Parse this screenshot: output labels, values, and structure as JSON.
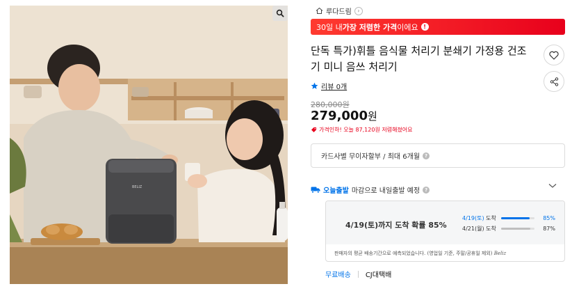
{
  "store": {
    "name": "루다드림",
    "chevron": "›"
  },
  "banner": {
    "prefix": "30일 내 ",
    "highlight": "가장 저렴한 가격",
    "suffix": "이에요",
    "info_icon": "!"
  },
  "product": {
    "title": "단독 특가)휘틀 음식물 처리기 분쇄기 가정용 건조기 미니 음쓰 처리기",
    "review_label": "리뷰 0개",
    "original_price": "280,000원",
    "sale_price_number": "279,000",
    "sale_price_unit": "원",
    "price_drop_note": "가격인하! 오늘 87,120원 저렴해졌어요"
  },
  "card_info": {
    "label": "카드사별 무이자할부 / 최대 6개월",
    "help": "?"
  },
  "shipping": {
    "badge": "오늘출발",
    "label": "마감으로 내일출발 예정",
    "help": "?"
  },
  "arrival": {
    "headline": "4/19(토)까지 도착 확률 85%",
    "stats": [
      {
        "date": "4/19(토)",
        "suffix": "도착",
        "percent": 85,
        "label": "85%",
        "color": "#0073e9"
      },
      {
        "date": "4/21(월)",
        "suffix": "도착",
        "percent": 87,
        "label": "87%",
        "color": "#bfbfbf"
      }
    ],
    "footnote": "판매자의 평균 배송기간으로 예측되었습니다. (영업일 기준, 주말/공휴일 제외)",
    "brand_mark": "Beliz"
  },
  "delivery": {
    "free": "무료배송",
    "courier": "CJ대택배"
  },
  "colors": {
    "accent_red": "#e8001c",
    "accent_blue": "#0073e9"
  },
  "icons": {
    "zoom": "magnifier-icon",
    "home": "home-icon",
    "heart": "heart-icon",
    "share": "share-icon",
    "star": "star-icon",
    "truck": "truck-icon",
    "chevron": "chevron-down-icon"
  }
}
